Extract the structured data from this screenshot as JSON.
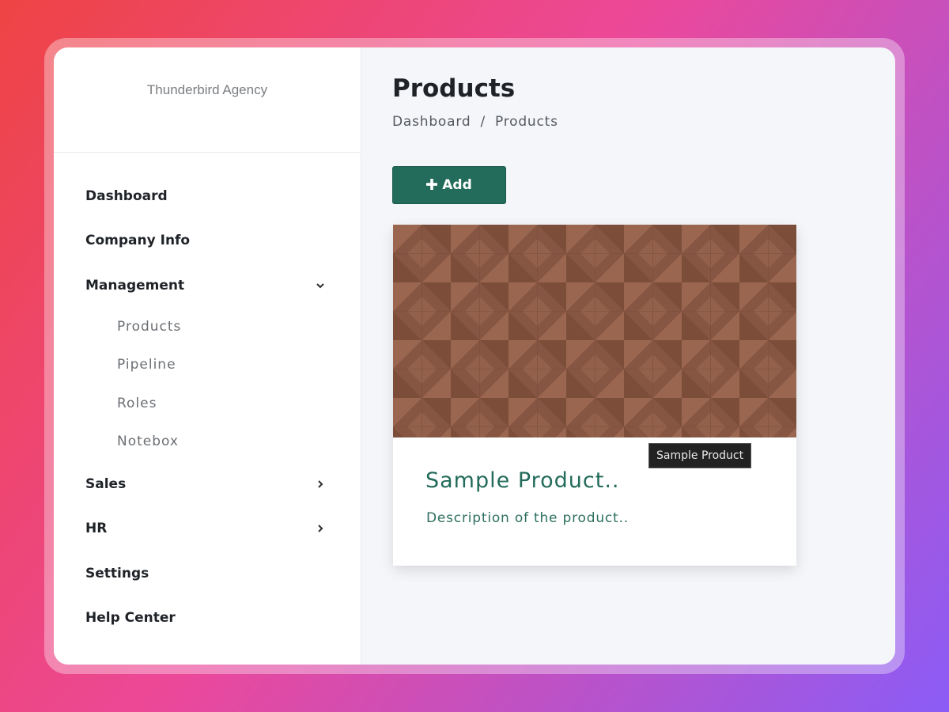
{
  "app": {
    "brand": "Thunderbird Agency"
  },
  "sidebar": {
    "items": [
      {
        "label": "Dashboard"
      },
      {
        "label": "Company Info"
      },
      {
        "label": "Management",
        "expanded": true,
        "icon": "chevron-down-icon"
      },
      {
        "label": "Sales",
        "icon": "chevron-right-icon"
      },
      {
        "label": "HR",
        "icon": "chevron-right-icon"
      },
      {
        "label": "Settings"
      },
      {
        "label": "Help Center"
      }
    ],
    "management_sub": [
      {
        "label": "Products"
      },
      {
        "label": "Pipeline"
      },
      {
        "label": "Roles"
      },
      {
        "label": "Notebox"
      }
    ]
  },
  "header": {
    "title": "Products",
    "breadcrumb": [
      "Dashboard",
      "/",
      "Products"
    ]
  },
  "toolbar": {
    "add_label": "Add",
    "add_icon": "plus-icon"
  },
  "products": [
    {
      "title": "Sample Product..",
      "description": "Description of the product..",
      "tooltip": "Sample Product"
    }
  ],
  "colors": {
    "accent": "#236b5a",
    "card_pattern": "#8b5a44",
    "background_gradient": [
      "#ef4444",
      "#ec4899",
      "#8b5cf6"
    ]
  }
}
